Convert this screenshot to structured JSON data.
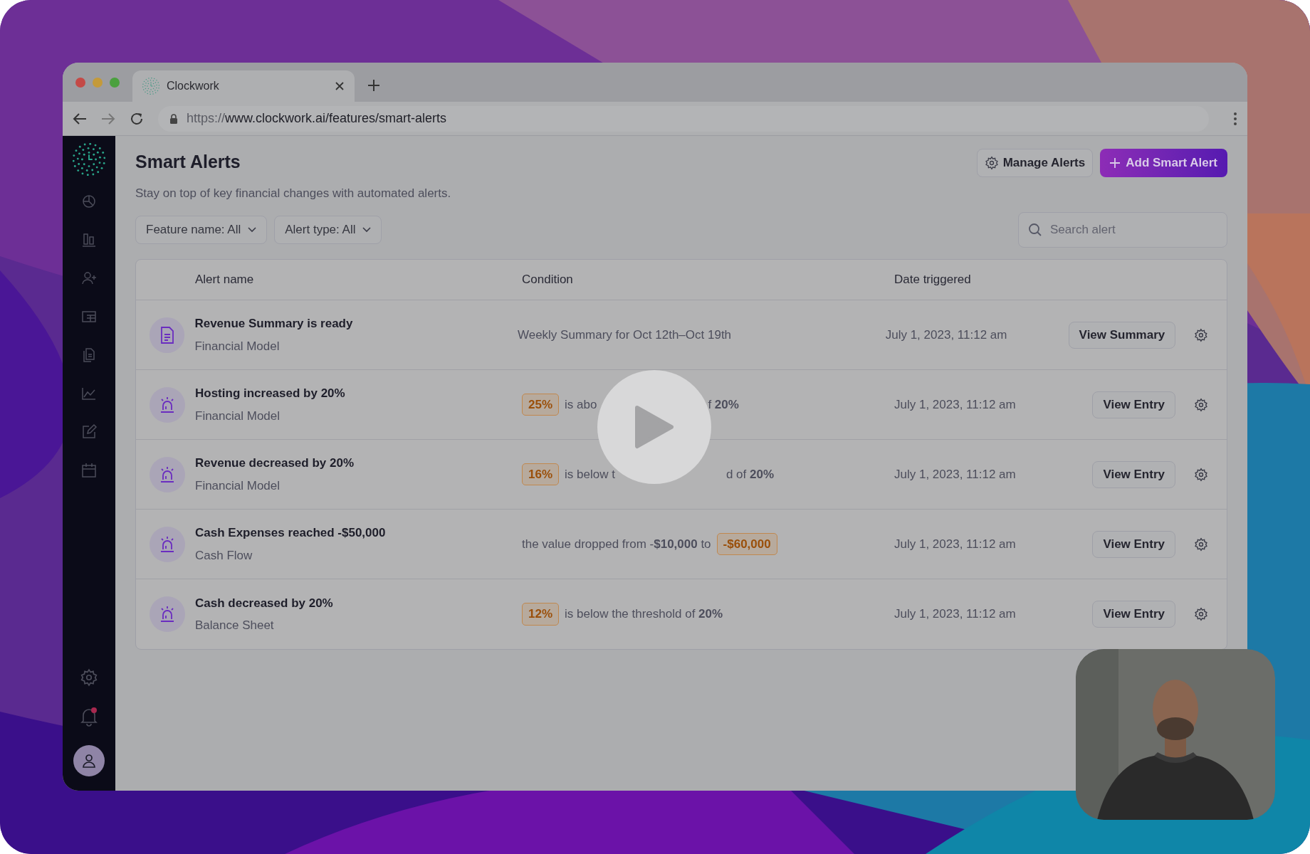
{
  "browser": {
    "tab_title": "Clockwork",
    "url_scheme": "https://",
    "url_host": "www.clockwork.ai/features/smart-alerts"
  },
  "page": {
    "title": "Smart Alerts",
    "subtitle": "Stay on top of key financial changes with automated alerts.",
    "buttons": [
      {
        "label": "Manage Alerts",
        "kind": "secondary"
      },
      {
        "label": "Add Smart Alert",
        "kind": "primary"
      }
    ],
    "filters": [
      {
        "label": "Feature name: All"
      },
      {
        "label": "Alert type: All"
      }
    ],
    "search": {
      "placeholder": "Search alert"
    }
  },
  "table": {
    "columns": [
      "Alert name",
      "Condition",
      "Date triggered"
    ],
    "rows": [
      {
        "kind": "summary",
        "name": "Revenue Summary is ready",
        "source": "Financial Model",
        "condition": [
          {
            "kind": "text",
            "text": "Weekly Summary for Oct 12th–Oct 19th"
          }
        ],
        "date": "July 1, 2023, 11:12 am",
        "action": "View Summary"
      },
      {
        "kind": "alert",
        "name": "Hosting increased by 20%",
        "source": "Financial Model",
        "condition": [
          {
            "kind": "badge",
            "text": "25%"
          },
          {
            "kind": "text",
            "text": "is abo"
          },
          {
            "kind": "covered"
          },
          {
            "kind": "text",
            "text": "f **20%**"
          }
        ],
        "date": "July 1, 2023, 11:12 am",
        "action": "View Entry"
      },
      {
        "kind": "alert",
        "name": "Revenue decreased by 20%",
        "source": "Financial Model",
        "condition": [
          {
            "kind": "badge",
            "text": "16%"
          },
          {
            "kind": "text",
            "text": "is below t"
          },
          {
            "kind": "covered"
          },
          {
            "kind": "text",
            "text": "d of **20%**"
          }
        ],
        "date": "July 1, 2023, 11:12 am",
        "action": "View Entry"
      },
      {
        "kind": "alert",
        "name": "Cash Expenses reached -$50,000",
        "source": "Cash Flow",
        "condition": [
          {
            "kind": "text",
            "text": "the value dropped from -**$10,000** to"
          },
          {
            "kind": "badge",
            "text": "-$60,000"
          }
        ],
        "date": "July 1, 2023, 11:12 am",
        "action": "View Entry"
      },
      {
        "kind": "alert",
        "name": "Cash decreased by 20%",
        "source": "Balance Sheet",
        "condition": [
          {
            "kind": "badge",
            "text": "12%"
          },
          {
            "kind": "text",
            "text": "is below the threshold of **20%**"
          }
        ],
        "date": "July 1, 2023, 11:12 am",
        "action": "View Entry"
      }
    ]
  }
}
